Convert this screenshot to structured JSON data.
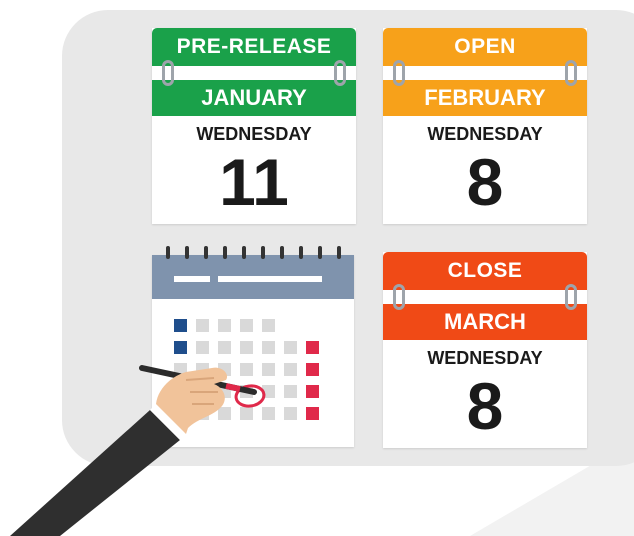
{
  "calendars": {
    "pre_release": {
      "status": "PRE-RELEASE",
      "month": "JANUARY",
      "weekday": "WEDNESDAY",
      "day": "11",
      "head_color": "#1aa14a",
      "month_color": "#1aa14a"
    },
    "open": {
      "status": "OPEN",
      "month": "FEBRUARY",
      "weekday": "WEDNESDAY",
      "day": "8",
      "head_color": "#f7a11a",
      "month_color": "#f7a11a"
    },
    "close": {
      "status": "CLOSE",
      "month": "MARCH",
      "weekday": "WEDNESDAY",
      "day": "8",
      "head_color": "#f04a16",
      "month_color": "#f04a16"
    }
  },
  "icons": {
    "month_calendar": "calendar-grid-icon",
    "hand": "hand-with-pen-icon",
    "circle_mark": "red-circle-mark-icon"
  },
  "colors": {
    "board": "#e8e8e8",
    "calendar_bar": "#7f93ad",
    "highlight_blue": "#1f4e8c",
    "highlight_red": "#e0294a"
  }
}
